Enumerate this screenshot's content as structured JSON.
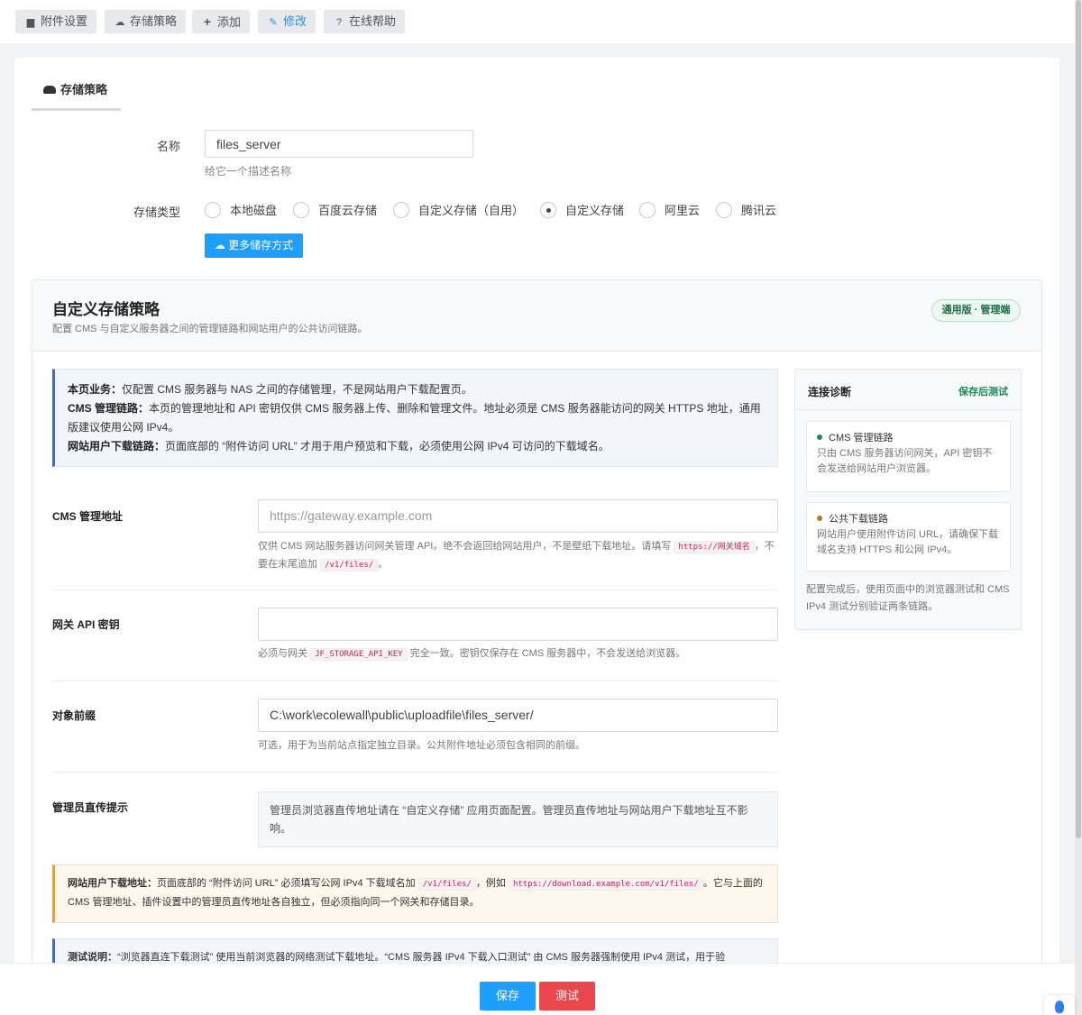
{
  "toolbar": {
    "items": [
      {
        "label": "附件设置",
        "icon": "folder-icon"
      },
      {
        "label": "存储策略",
        "icon": "cloud-icon"
      },
      {
        "label": "添加",
        "icon": "plus-icon"
      },
      {
        "label": "修改",
        "icon": "edit-icon"
      },
      {
        "label": "在线帮助",
        "icon": "help-icon"
      }
    ],
    "active_color": "#2e8de6"
  },
  "tab": {
    "title": "存储策略"
  },
  "form": {
    "name_label": "名称",
    "name_value": "files_server",
    "name_hint": "给它一个描述名称",
    "type_label": "存储类型",
    "types": [
      {
        "label": "本地磁盘",
        "selected": false
      },
      {
        "label": "百度云存储",
        "selected": false
      },
      {
        "label": "自定义存储（自用）",
        "selected": false
      },
      {
        "label": "自定义存储",
        "selected": true
      },
      {
        "label": "阿里云",
        "selected": false
      },
      {
        "label": "腾讯云",
        "selected": false
      }
    ],
    "more_button": "更多储存方式"
  },
  "panel": {
    "title": "自定义存储策略",
    "subtitle": "配置 CMS 与自定义服务器之间的管理链路和网站用户的公共访问链路。",
    "badge": "通用版 · 管理端",
    "note": {
      "l1_head": "本页业务：",
      "l1_text": "仅配置 CMS 服务器与 NAS 之间的存储管理，不是网站用户下载配置页。",
      "l2_head": "CMS 管理链路：",
      "l2_text": "本页的管理地址和 API 密钥仅供 CMS 服务器上传、删除和管理文件。地址必须是 CMS 服务器能访问的网关 HTTPS 地址，通用版建议使用公网 IPv4。",
      "l3_head": "网站用户下载链路：",
      "l3_text": "页面底部的 “附件访问 URL” 才用于用户预览和下载，必须使用公网 IPv4 可访问的下载域名。"
    },
    "cms_url": {
      "label": "CMS 管理地址",
      "placeholder": "https://gateway.example.com",
      "desc_a": "仅供 CMS 网站服务器访问网关管理 API。绝不会返回给网站用户，不是壁纸下载地址。请填写 ",
      "code_a": "https://网关域名",
      "desc_b": "，不要在末尾追加 ",
      "code_b": "/v1/files/",
      "desc_c": "。"
    },
    "api_key": {
      "label": "网关 API 密钥",
      "value": "",
      "desc_a": "必须与网关 ",
      "code": "JF_STORAGE_API_KEY",
      "desc_b": " 完全一致。密钥仅保存在 CMS 服务器中，不会发送给浏览器。"
    },
    "prefix": {
      "label": "对象前缀",
      "value": "C:\\work\\ecolewall\\public\\uploadfile\\files_server/",
      "desc": "可选，用于为当前站点指定独立目录。公共附件地址必须包含相同的前缀。"
    },
    "admin_tip": {
      "label": "管理员直传提示",
      "text": "管理员浏览器直传地址请在 “自定义存储” 应用页面配置。管理员直传地址与网站用户下载地址互不影响。"
    },
    "warn": {
      "head": "网站用户下载地址：",
      "text_a": "页面底部的 “附件访问 URL” 必须填写公网 IPv4 下载域名加 ",
      "code_a": "/v1/files/",
      "text_b": "，例如 ",
      "code_b": "https://download.example.com/v1/files/",
      "text_c": "。它与上面的 CMS 管理地址、插件设置中的管理员直传地址各自独立，但必须指向同一个网关和存储目录。"
    },
    "test_note": {
      "head": "测试说明：",
      "text": "“浏览器直连下载测试” 使用当前浏览器的网络测试下载地址。“CMS 服务器 IPv4 下载入口测试” 由 CMS 服务器强制使用 IPv4 测试，用于验"
    },
    "diagnostics": {
      "title": "连接诊断",
      "link": "保存后测试",
      "cards": [
        {
          "title": "CMS 管理链路",
          "text": "只由 CMS 服务器访问网关，API 密钥不会发送给网站用户浏览器。",
          "color": "#1f8a55"
        },
        {
          "title": "公共下载链路",
          "text": "网站用户使用附件访问 URL，请确保下载域名支持 HTTPS 和公网 IPv4。",
          "color": "#b8791d"
        }
      ],
      "footer": "配置完成后，使用页面中的浏览器测试和 CMS IPv4 测试分别验证两条链路。"
    }
  },
  "actions": {
    "save": "保存",
    "test": "测试",
    "save_color": "#1e9fff",
    "test_color": "#e9474b"
  }
}
